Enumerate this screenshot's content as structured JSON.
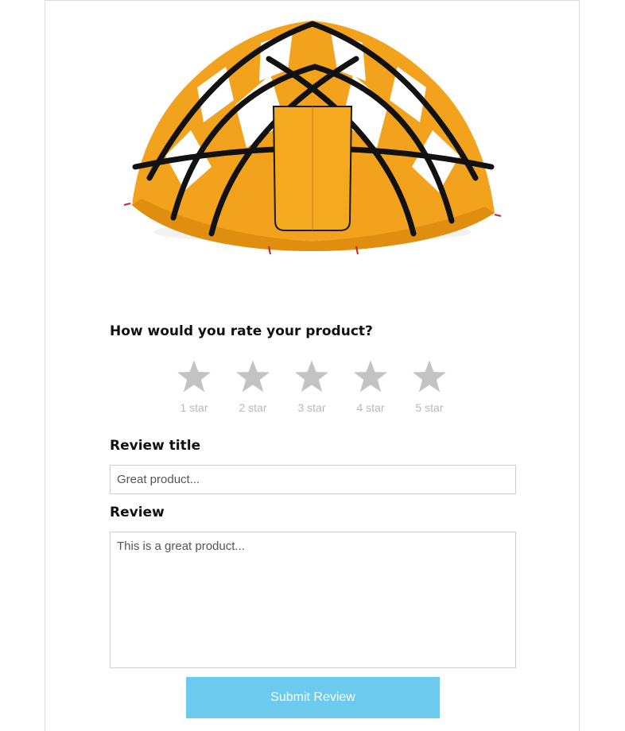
{
  "product": {
    "image_icon": "dome-tent-image"
  },
  "rating": {
    "question": "How would you rate your product?",
    "stars": [
      {
        "caption": "1 star"
      },
      {
        "caption": "2 star"
      },
      {
        "caption": "3 star"
      },
      {
        "caption": "4 star"
      },
      {
        "caption": "5 star"
      }
    ],
    "selected": 0,
    "star_color": "#c3c3c3"
  },
  "review_title": {
    "label": "Review title",
    "placeholder": "Great product..."
  },
  "review": {
    "label": "Review",
    "placeholder": "This is a great product..."
  },
  "submit": {
    "label": "Submit Review",
    "color": "#6ccaee"
  }
}
